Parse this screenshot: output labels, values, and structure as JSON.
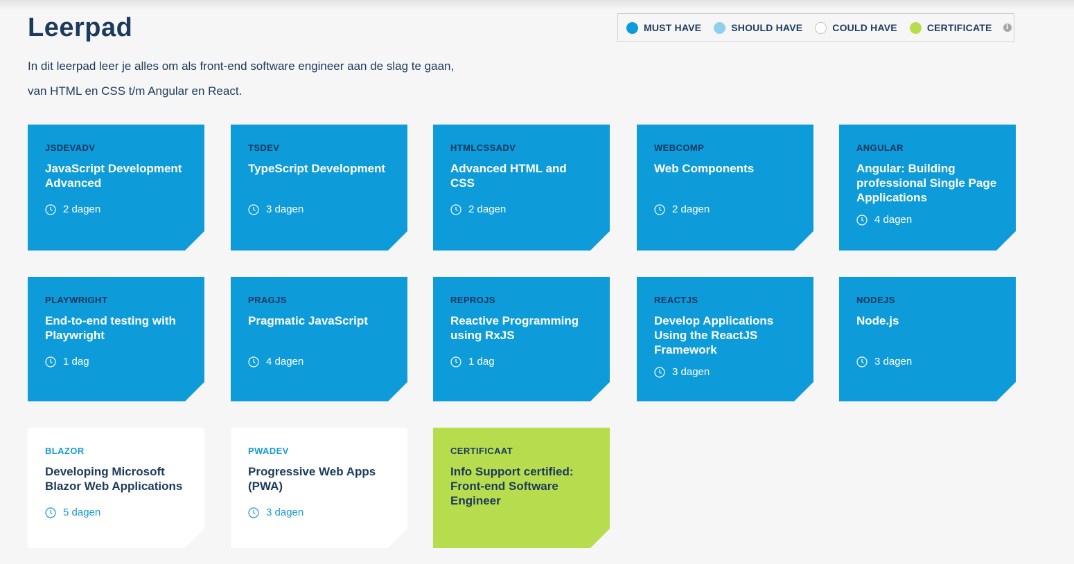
{
  "page": {
    "title": "Leerpad",
    "intro_line1": "In dit leerpad leer je alles om als front-end software engineer aan de slag te gaan,",
    "intro_line2": "van HTML en CSS t/m Angular en React."
  },
  "legend": {
    "items": [
      {
        "label": "MUST HAVE",
        "color": "#0e9bda"
      },
      {
        "label": "SHOULD HAVE",
        "color": "#8fd0ef"
      },
      {
        "label": "COULD HAVE",
        "color": "#ffffff"
      },
      {
        "label": "CERTIFICATE",
        "color": "#b7dd4f"
      }
    ],
    "info_icon": "info-icon"
  },
  "courses": [
    {
      "code": "JSDEVADV",
      "name": "JavaScript Development Advanced",
      "duration": "2 dagen",
      "level": "must"
    },
    {
      "code": "TSDEV",
      "name": "TypeScript Development",
      "duration": "3 dagen",
      "level": "must"
    },
    {
      "code": "HTMLCSSADV",
      "name": "Advanced HTML and CSS",
      "duration": "2 dagen",
      "level": "must"
    },
    {
      "code": "WEBCOMP",
      "name": "Web Components",
      "duration": "2 dagen",
      "level": "must"
    },
    {
      "code": "ANGULAR",
      "name": "Angular: Building professional Single Page Applications",
      "duration": "4 dagen",
      "level": "must"
    },
    {
      "code": "PLAYWRIGHT",
      "name": "End-to-end testing with Playwright",
      "duration": "1 dag",
      "level": "must"
    },
    {
      "code": "PRAGJS",
      "name": "Pragmatic JavaScript",
      "duration": "4 dagen",
      "level": "must"
    },
    {
      "code": "REPROJS",
      "name": "Reactive Programming using RxJS",
      "duration": "1 dag",
      "level": "must"
    },
    {
      "code": "REACTJS",
      "name": "Develop Applications Using the ReactJS Framework",
      "duration": "3 dagen",
      "level": "must"
    },
    {
      "code": "NODEJS",
      "name": "Node.js",
      "duration": "3 dagen",
      "level": "must"
    },
    {
      "code": "BLAZOR",
      "name": "Developing Microsoft Blazor Web Applications",
      "duration": "5 dagen",
      "level": "could"
    },
    {
      "code": "PWADEV",
      "name": "Progressive Web Apps (PWA)",
      "duration": "3 dagen",
      "level": "could"
    },
    {
      "code": "CERTIFICAAT",
      "name": "Info Support certified: Front-end Software Engineer",
      "level": "cert"
    }
  ],
  "colors": {
    "must": "#0e9bda",
    "should": "#8fd0ef",
    "could": "#ffffff",
    "certificate": "#b7dd4f",
    "text_dark": "#1b3a5c"
  }
}
